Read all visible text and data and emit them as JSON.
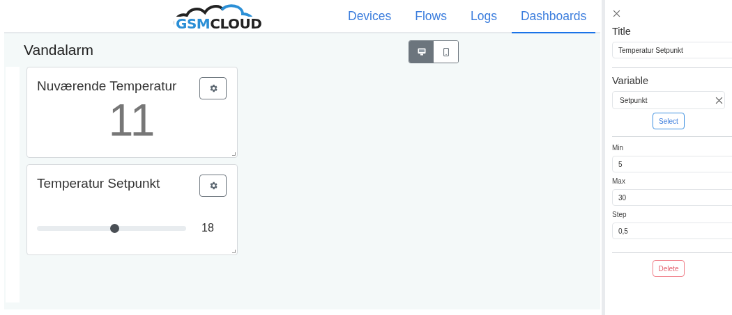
{
  "logo": {
    "prefix": "GSM",
    "suffix": "CLOUD"
  },
  "nav": [
    {
      "label": "Devices",
      "selected": false
    },
    {
      "label": "Flows",
      "selected": false
    },
    {
      "label": "Logs",
      "selected": false
    },
    {
      "label": "Dashboards",
      "selected": true
    }
  ],
  "dashboard": {
    "title": "Vandalarm",
    "view_toggle": [
      {
        "kind": "desktop",
        "selected": true
      },
      {
        "kind": "mobile",
        "selected": false
      }
    ],
    "widgets": [
      {
        "kind": "value",
        "title": "Nuværende Temperatur",
        "value": "11"
      },
      {
        "kind": "slider",
        "title": "Temperatur Setpunkt",
        "level": 0.52,
        "reading": "18"
      }
    ]
  },
  "panel": {
    "title_label": "Title",
    "title_value": "Temperatur Setpunkt",
    "variable_label": "Variable",
    "variable_value": "Setpunkt",
    "select_button": "Select",
    "fields": [
      {
        "label": "Min",
        "value": "5"
      },
      {
        "label": "Max",
        "value": "30"
      },
      {
        "label": "Step",
        "value": "0,5"
      }
    ],
    "delete_button": "Delete"
  }
}
